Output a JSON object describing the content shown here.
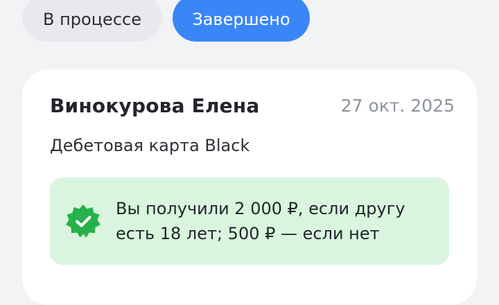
{
  "filters": {
    "in_progress_label": "В процессе",
    "completed_label": "Завершено"
  },
  "card": {
    "name": "Винокурова Елена",
    "date": "27 окт. 2025",
    "product": "Дебетовая карта Black",
    "reward": {
      "icon": "verified-badge-icon",
      "text": "Вы получили 2 000 ₽, если другу есть 18 лет; 500 ₽ — если нет"
    }
  },
  "colors": {
    "accent": "#3b86f7",
    "success_bg": "#d9f5de",
    "success_icon": "#27b14a"
  }
}
